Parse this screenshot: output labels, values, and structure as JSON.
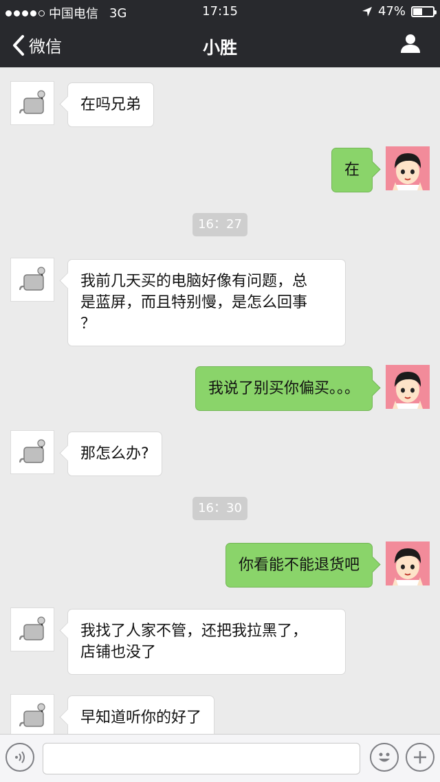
{
  "status_bar": {
    "carrier": "中国电信",
    "network": "3G",
    "time": "17:15",
    "battery": "47%",
    "battery_level": 0.47,
    "signal_bars_filled": 4,
    "signal_bars_total": 5
  },
  "nav": {
    "back_label": "微信",
    "title": "小胜",
    "profile_icon": "person-icon"
  },
  "messages": [
    {
      "side": "in",
      "text": "在吗兄弟"
    },
    {
      "side": "out",
      "text": "在"
    },
    {
      "timestamp": "16：27"
    },
    {
      "side": "in",
      "text_lines": [
        "我前几天买的电脑好像有问题，总",
        "是蓝屏，而且特别慢，是怎么回事",
        "？"
      ]
    },
    {
      "side": "out",
      "text": "我说了别买你偏买。。。"
    },
    {
      "side": "in",
      "text": "那怎么办?"
    },
    {
      "timestamp": "16：30"
    },
    {
      "side": "out",
      "text": "你看能不能退货吧"
    },
    {
      "side": "in",
      "text_lines": [
        "我找了人家不管，还把我拉黑了，",
        "店铺也没了"
      ]
    },
    {
      "side": "in",
      "text": "早知道听你的好了"
    }
  ],
  "input_bar": {
    "voice_icon": "voice-icon",
    "emoji_icon": "emoji-icon",
    "plus_icon": "plus-icon",
    "placeholder": ""
  },
  "colors": {
    "header_bg": "#28292d",
    "chat_bg": "#ebebeb",
    "outgoing_bubble": "#8ad46a",
    "incoming_bubble": "#ffffff"
  }
}
